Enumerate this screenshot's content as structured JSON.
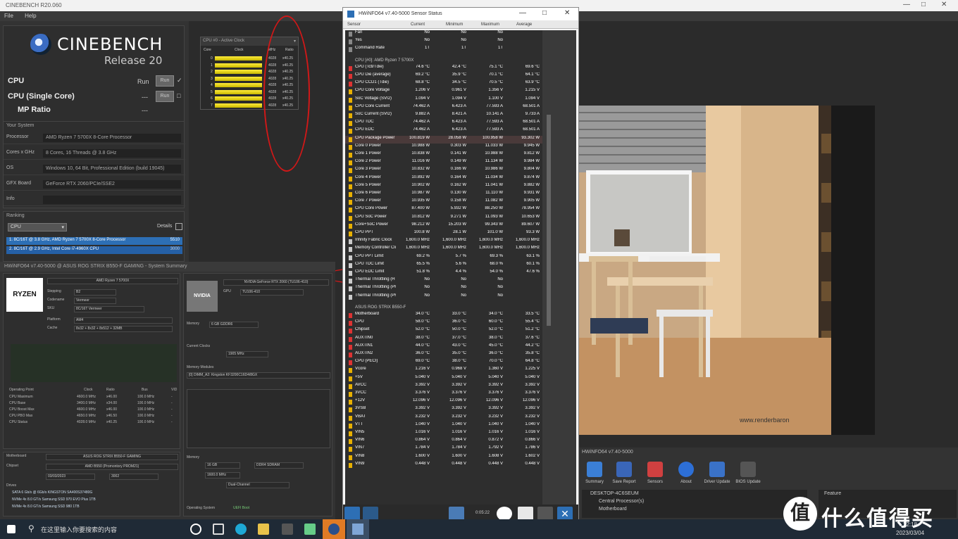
{
  "cinebench": {
    "window_title": "CINEBENCH R20.060",
    "menu": [
      "File",
      "Help"
    ],
    "logo_name": "CINEBENCH",
    "logo_release": "Release 20",
    "tests": [
      {
        "label": "CPU",
        "value": "Run",
        "btn": "Run"
      },
      {
        "label": "CPU (Single Core)",
        "value": "---",
        "btn": "Run"
      },
      {
        "label": "MP Ratio",
        "value": "---",
        "btn": ""
      }
    ],
    "system_header": "Your System",
    "system": [
      {
        "label": "Processor",
        "value": "AMD Ryzen 7 5700X 8-Core Processor"
      },
      {
        "label": "Cores x GHz",
        "value": "8 Cores, 16 Threads @ 3.8 GHz"
      },
      {
        "label": "OS",
        "value": "Windows 10, 64 Bit, Professional Edition (build 19045)"
      },
      {
        "label": "GFX Board",
        "value": "GeForce RTX 2060/PCIe/SSE2"
      },
      {
        "label": "Info",
        "value": ""
      }
    ],
    "ranking_header": "Ranking",
    "ranking_select": "CPU",
    "ranking_details": "Details",
    "ranking": [
      {
        "label": "1. 8C/16T @ 3.8 GHz, AMD Ryzen 7 5700X 8-Core Processor",
        "score": "5510"
      },
      {
        "label": "2. 8C/16T @ 2.9 GHz, Intel Core i7-4960X CPU",
        "score": "3000"
      }
    ]
  },
  "cpu_usage": {
    "title": "CPU #0 - Active Clock",
    "headers": [
      "Core",
      "Clock",
      "MHz",
      "Ratio"
    ],
    "values": [
      0.95,
      0.95,
      0.95,
      0.95,
      0.95,
      0.95,
      0.95,
      0.95
    ],
    "mhz": [
      "4028",
      "4028",
      "4028",
      "4028",
      "4028",
      "4028",
      "4028",
      "4028"
    ],
    "ratio": [
      "x40.25",
      "x40.25",
      "x40.25",
      "x40.25",
      "x40.25",
      "x40.25",
      "x40.25",
      "x40.25"
    ]
  },
  "sensor": {
    "title": "HWiNFO64 v7.40-5000 Sensor Status",
    "columns": [
      "Sensor",
      "Current",
      "Minimum",
      "Maximum",
      "Average"
    ],
    "groups": [
      {
        "name": "",
        "rows": [
          {
            "n": "Fan",
            "c": "No",
            "mi": "No",
            "ma": "No",
            "av": "",
            "color": "#888"
          },
          {
            "n": "Yes",
            "c": "No",
            "mi": "No",
            "ma": "No",
            "av": "",
            "color": "#888"
          },
          {
            "n": "Command Rate",
            "c": "1T",
            "mi": "1T",
            "ma": "1T",
            "av": "",
            "color": "#888"
          }
        ]
      },
      {
        "name": "CPU [#0]: AMD Ryzen 7 5700X",
        "rows": [
          {
            "n": "CPU (Tctl/Tdie)",
            "c": "74.6 °C",
            "mi": "42.4 °C",
            "ma": "75.1 °C",
            "av": "69.6 °C",
            "color": "#d33"
          },
          {
            "n": "CPU Die (average)",
            "c": "69.2 °C",
            "mi": "35.9 °C",
            "ma": "70.1 °C",
            "av": "64.1 °C",
            "color": "#d33"
          },
          {
            "n": "CPU CCD1 (Tdie)",
            "c": "68.8 °C",
            "mi": "34.5 °C",
            "ma": "70.5 °C",
            "av": "63.9 °C",
            "color": "#d33"
          },
          {
            "n": "CPU Core Voltage",
            "c": "1.206 V",
            "mi": "0.961 V",
            "ma": "1.356 V",
            "av": "1.215 V",
            "color": "#e8b000"
          },
          {
            "n": "SoC Voltage (SVI2)",
            "c": "1.094 V",
            "mi": "1.094 V",
            "ma": "1.100 V",
            "av": "1.094 V",
            "color": "#e8b000"
          },
          {
            "n": "CPU Core Current",
            "c": "74.462 A",
            "mi": "6.423 A",
            "ma": "77.593 A",
            "av": "68.501 A",
            "color": "#e8b000"
          },
          {
            "n": "SoC Current (SVI2)",
            "c": "9.882 A",
            "mi": "8.421 A",
            "ma": "10.141 A",
            "av": "9.733 A",
            "color": "#e8b000"
          },
          {
            "n": "CPU TDC",
            "c": "74.462 A",
            "mi": "6.423 A",
            "ma": "77.593 A",
            "av": "68.501 A",
            "color": "#e8b000"
          },
          {
            "n": "CPU EDC",
            "c": "74.462 A",
            "mi": "6.423 A",
            "ma": "77.593 A",
            "av": "68.501 A",
            "color": "#e8b000"
          },
          {
            "n": "CPU Package Power",
            "c": "100.819 W",
            "mi": "28.058 W",
            "ma": "100.958 W",
            "av": "93.302 W",
            "color": "#e8b000",
            "hl": true
          },
          {
            "n": "Core 0 Power",
            "c": "10.988 W",
            "mi": "0.303 W",
            "ma": "11.033 W",
            "av": "9.945 W",
            "color": "#e8b000"
          },
          {
            "n": "Core 1 Power",
            "c": "10.838 W",
            "mi": "0.141 W",
            "ma": "10.988 W",
            "av": "9.812 W",
            "color": "#e8b000"
          },
          {
            "n": "Core 2 Power",
            "c": "11.016 W",
            "mi": "0.149 W",
            "ma": "11.134 W",
            "av": "9.984 W",
            "color": "#e8b000"
          },
          {
            "n": "Core 3 Power",
            "c": "10.832 W",
            "mi": "0.166 W",
            "ma": "10.986 W",
            "av": "9.804 W",
            "color": "#e8b000"
          },
          {
            "n": "Core 4 Power",
            "c": "10.892 W",
            "mi": "0.164 W",
            "ma": "11.034 W",
            "av": "9.874 W",
            "color": "#e8b000"
          },
          {
            "n": "Core 5 Power",
            "c": "10.902 W",
            "mi": "0.162 W",
            "ma": "11.041 W",
            "av": "9.882 W",
            "color": "#e8b000"
          },
          {
            "n": "Core 6 Power",
            "c": "10.987 W",
            "mi": "0.130 W",
            "ma": "11.110 W",
            "av": "9.931 W",
            "color": "#e8b000"
          },
          {
            "n": "Core 7 Power",
            "c": "10.935 W",
            "mi": "0.158 W",
            "ma": "11.082 W",
            "av": "9.905 W",
            "color": "#e8b000"
          },
          {
            "n": "CPU Core Power",
            "c": "87.400 W",
            "mi": "5.932 W",
            "ma": "88.250 W",
            "av": "78.954 W",
            "color": "#e8b000"
          },
          {
            "n": "CPU SoC Power",
            "c": "10.812 W",
            "mi": "9.271 W",
            "ma": "11.093 W",
            "av": "10.653 W",
            "color": "#e8b000"
          },
          {
            "n": "Core+SoC Power",
            "c": "98.212 W",
            "mi": "15.203 W",
            "ma": "99.343 W",
            "av": "89.607 W",
            "color": "#e8b000"
          },
          {
            "n": "CPU PPT",
            "c": "100.8 W",
            "mi": "28.1 W",
            "ma": "101.0 W",
            "av": "93.3 W",
            "color": "#e8b000"
          },
          {
            "n": "Infinity Fabric Clock",
            "c": "1,600.0 MHz",
            "mi": "1,600.0 MHz",
            "ma": "1,600.0 MHz",
            "av": "1,600.0 MHz",
            "color": "#ccc"
          },
          {
            "n": "Memory Controller Clock",
            "c": "1,600.0 MHz",
            "mi": "1,600.0 MHz",
            "ma": "1,600.0 MHz",
            "av": "1,600.0 MHz",
            "color": "#ccc"
          },
          {
            "n": "CPU PPT Limit",
            "c": "69.2 %",
            "mi": "5.7 %",
            "ma": "69.3 %",
            "av": "63.1 %",
            "color": "#ccc"
          },
          {
            "n": "CPU TDC Limit",
            "c": "65.5 %",
            "mi": "5.6 %",
            "ma": "68.0 %",
            "av": "60.1 %",
            "color": "#ccc"
          },
          {
            "n": "CPU EDC Limit",
            "c": "51.8 %",
            "mi": "4.4 %",
            "ma": "54.0 %",
            "av": "47.6 %",
            "color": "#ccc"
          },
          {
            "n": "Thermal Throttling (HTC)",
            "c": "No",
            "mi": "No",
            "ma": "No",
            "av": "",
            "color": "#ccc"
          },
          {
            "n": "Thermal Throttling (PROCHOT CPU)",
            "c": "No",
            "mi": "No",
            "ma": "No",
            "av": "",
            "color": "#ccc"
          },
          {
            "n": "Thermal Throttling (PROCHOT EXT)",
            "c": "No",
            "mi": "No",
            "ma": "No",
            "av": "",
            "color": "#ccc"
          }
        ]
      },
      {
        "name": "ASUS ROG STRIX B550-F",
        "rows": [
          {
            "n": "Motherboard",
            "c": "34.0 °C",
            "mi": "33.0 °C",
            "ma": "34.0 °C",
            "av": "33.5 °C",
            "color": "#d33"
          },
          {
            "n": "CPU",
            "c": "58.0 °C",
            "mi": "36.0 °C",
            "ma": "60.0 °C",
            "av": "55.4 °C",
            "color": "#d33"
          },
          {
            "n": "Chipset",
            "c": "52.0 °C",
            "mi": "50.0 °C",
            "ma": "52.0 °C",
            "av": "51.2 °C",
            "color": "#d33"
          },
          {
            "n": "AUXTIN0",
            "c": "38.0 °C",
            "mi": "37.0 °C",
            "ma": "38.0 °C",
            "av": "37.6 °C",
            "color": "#d33"
          },
          {
            "n": "AUXTIN1",
            "c": "44.0 °C",
            "mi": "43.0 °C",
            "ma": "45.0 °C",
            "av": "44.2 °C",
            "color": "#d33"
          },
          {
            "n": "AUXTIN2",
            "c": "36.0 °C",
            "mi": "35.0 °C",
            "ma": "36.0 °C",
            "av": "35.8 °C",
            "color": "#d33"
          },
          {
            "n": "CPU (PECI)",
            "c": "69.0 °C",
            "mi": "38.0 °C",
            "ma": "70.0 °C",
            "av": "64.8 °C",
            "color": "#d33"
          },
          {
            "n": "Vcore",
            "c": "1.216 V",
            "mi": "0.968 V",
            "ma": "1.360 V",
            "av": "1.225 V",
            "color": "#e8b000"
          },
          {
            "n": "+5V",
            "c": "5.040 V",
            "mi": "5.040 V",
            "ma": "5.040 V",
            "av": "5.040 V",
            "color": "#e8b000"
          },
          {
            "n": "AVCC",
            "c": "3.392 V",
            "mi": "3.392 V",
            "ma": "3.392 V",
            "av": "3.392 V",
            "color": "#e8b000"
          },
          {
            "n": "3VCC",
            "c": "3.376 V",
            "mi": "3.376 V",
            "ma": "3.376 V",
            "av": "3.376 V",
            "color": "#e8b000"
          },
          {
            "n": "+12V",
            "c": "12.096 V",
            "mi": "12.096 V",
            "ma": "12.096 V",
            "av": "12.096 V",
            "color": "#e8b000"
          },
          {
            "n": "3VSB",
            "c": "3.392 V",
            "mi": "3.392 V",
            "ma": "3.392 V",
            "av": "3.392 V",
            "color": "#e8b000"
          },
          {
            "n": "VBAT",
            "c": "3.232 V",
            "mi": "3.232 V",
            "ma": "3.232 V",
            "av": "3.232 V",
            "color": "#e8b000"
          },
          {
            "n": "VTT",
            "c": "1.040 V",
            "mi": "1.040 V",
            "ma": "1.040 V",
            "av": "1.040 V",
            "color": "#e8b000"
          },
          {
            "n": "VIN5",
            "c": "1.016 V",
            "mi": "1.016 V",
            "ma": "1.016 V",
            "av": "1.016 V",
            "color": "#e8b000"
          },
          {
            "n": "VIN6",
            "c": "0.864 V",
            "mi": "0.864 V",
            "ma": "0.872 V",
            "av": "0.866 V",
            "color": "#e8b000"
          },
          {
            "n": "VIN7",
            "c": "1.784 V",
            "mi": "1.784 V",
            "ma": "1.792 V",
            "av": "1.786 V",
            "color": "#e8b000"
          },
          {
            "n": "VIN8",
            "c": "1.600 V",
            "mi": "1.600 V",
            "ma": "1.608 V",
            "av": "1.602 V",
            "color": "#e8b000"
          },
          {
            "n": "VIN9",
            "c": "0.448 V",
            "mi": "0.448 V",
            "ma": "0.448 V",
            "av": "0.448 V",
            "color": "#e8b000"
          }
        ]
      }
    ],
    "timer": "0:05:22"
  },
  "summary": {
    "title": "HWiNFO64 v7.40-5000 @ ASUS ROG STRIX B550-F GAMING - System Summary",
    "cpu_name": "AMD Ryzen 7 5700X",
    "cpu_brand": "RYZEN",
    "gpu_name": "NVIDIA GeForce RTX 2060 (TU106-410)",
    "gpu_brand": "NVIDIA",
    "fields_cpu": [
      {
        "l": "Stepping",
        "v": "B2"
      },
      {
        "l": "Codename",
        "v": "Vermeer"
      },
      {
        "l": "SKU",
        "v": "8C/16T Vermeer"
      },
      {
        "l": "Platform",
        "v": "AM4"
      },
      {
        "l": "Cache",
        "v": "8x32 + 8x32 + 8x512 + 32MB"
      }
    ],
    "op_points_headers": [
      "Operating Point",
      "Clock",
      "Ratio",
      "Bus",
      "VID"
    ],
    "op_points": [
      [
        "CPU Maximum",
        "4600.0 MHz",
        "x46.00",
        "100.0 MHz",
        "-"
      ],
      [
        "CPU Base",
        "3400.0 MHz",
        "x34.00",
        "100.0 MHz",
        "-"
      ],
      [
        "CPU Boost Max",
        "4600.0 MHz",
        "x46.00",
        "100.0 MHz",
        "-"
      ],
      [
        "CPU PBO Max",
        "4650.0 MHz",
        "x46.50",
        "100.0 MHz",
        "-"
      ],
      [
        "CPU Status",
        "4028.0 MHz",
        "x40.25",
        "100.0 MHz",
        "-"
      ]
    ],
    "motherboard_label": "Motherboard",
    "motherboard": "ASUS ROG STRIX B550-F GAMING",
    "chipset_label": "Chipset",
    "chipset": "AMD B550 (Promontory PROM21)",
    "bios_date": "03/03/2023",
    "bios_version": "3002",
    "drives_label": "Drives",
    "drives": [
      "SATA 6 Gb/s @ 6Gb/s  KINGSTON SA400S37480G",
      "NVMe 4x 8.0 GT/s  Samsung SSD 970 EVO Plus 1TB",
      "NVMe 4x 8.0 GT/s  Samsung SSD 980 1TB"
    ],
    "memory_label": "Memory Modules",
    "memory_modules": "[0] DIMM_A2: Kingston KF3200C16D4/8GX",
    "memory_label2": "Memory",
    "memory_size": "16 GB",
    "memory_type": "DDR4 SDRAM",
    "memory_clock": "1600.0 MHz",
    "memory_mode": "Dual-Channel",
    "os_label": "Operating System",
    "os_value": "UEFI Boot",
    "gpu_fields": [
      {
        "l": "GPU",
        "v": "TU106-410"
      },
      {
        "l": "Memory",
        "v": "6 GB GDDR6"
      },
      {
        "l": "Current Clocks",
        "v": "1905 MHz"
      }
    ]
  },
  "hwinfo_main": {
    "title": "HWiNFO64 v7.40-5000",
    "buttons": [
      "Summary",
      "Save Report",
      "Sensors",
      "About",
      "Driver Update",
      "BIOS Update"
    ],
    "tree_root": "DESKTOP-4C6SEUM",
    "tree_items": [
      "Central Processor(s)",
      "Motherboard"
    ],
    "feature_header": "Feature"
  },
  "render": {
    "watermark": "www.renderbaron"
  },
  "taskbar": {
    "search_placeholder": "在这里输入你要搜索的内容",
    "time": "22:18",
    "date": "2023/03/04"
  },
  "watermark": {
    "logo": "值",
    "text": "什么值得买"
  }
}
